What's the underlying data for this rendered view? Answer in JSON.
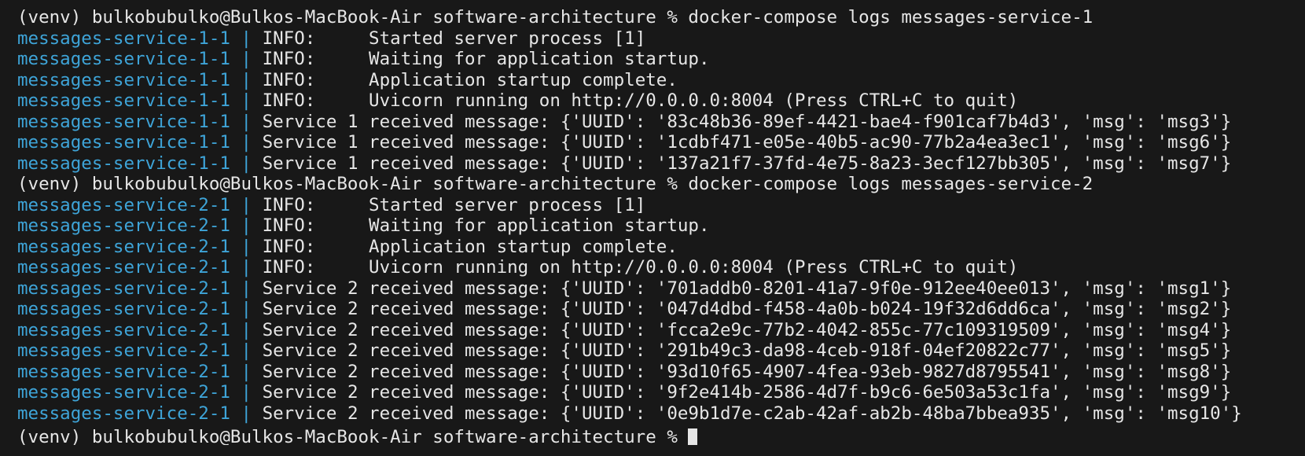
{
  "terminal": {
    "lines": [
      {
        "type": "prompt",
        "text": "(venv) bulkobubulko@Bulkos-MacBook-Air software-architecture % docker-compose logs messages-service-1"
      },
      {
        "type": "log",
        "service": "messages-service-1-1",
        "sep": " | ",
        "message": "INFO:     Started server process [1]"
      },
      {
        "type": "log",
        "service": "messages-service-1-1",
        "sep": " | ",
        "message": "INFO:     Waiting for application startup."
      },
      {
        "type": "log",
        "service": "messages-service-1-1",
        "sep": " | ",
        "message": "INFO:     Application startup complete."
      },
      {
        "type": "log",
        "service": "messages-service-1-1",
        "sep": " | ",
        "message": "INFO:     Uvicorn running on http://0.0.0.0:8004 (Press CTRL+C to quit)"
      },
      {
        "type": "log",
        "service": "messages-service-1-1",
        "sep": " | ",
        "message": "Service 1 received message: {'UUID': '83c48b36-89ef-4421-bae4-f901caf7b4d3', 'msg': 'msg3'}"
      },
      {
        "type": "log",
        "service": "messages-service-1-1",
        "sep": " | ",
        "message": "Service 1 received message: {'UUID': '1cdbf471-e05e-40b5-ac90-77b2a4ea3ec1', 'msg': 'msg6'}"
      },
      {
        "type": "log",
        "service": "messages-service-1-1",
        "sep": " | ",
        "message": "Service 1 received message: {'UUID': '137a21f7-37fd-4e75-8a23-3ecf127bb305', 'msg': 'msg7'}"
      },
      {
        "type": "prompt",
        "text": "(venv) bulkobubulko@Bulkos-MacBook-Air software-architecture % docker-compose logs messages-service-2"
      },
      {
        "type": "log",
        "service": "messages-service-2-1",
        "sep": " | ",
        "message": "INFO:     Started server process [1]"
      },
      {
        "type": "log",
        "service": "messages-service-2-1",
        "sep": " | ",
        "message": "INFO:     Waiting for application startup."
      },
      {
        "type": "log",
        "service": "messages-service-2-1",
        "sep": " | ",
        "message": "INFO:     Application startup complete."
      },
      {
        "type": "log",
        "service": "messages-service-2-1",
        "sep": " | ",
        "message": "INFO:     Uvicorn running on http://0.0.0.0:8004 (Press CTRL+C to quit)"
      },
      {
        "type": "log",
        "service": "messages-service-2-1",
        "sep": " | ",
        "message": "Service 2 received message: {'UUID': '701addb0-8201-41a7-9f0e-912ee40ee013', 'msg': 'msg1'}"
      },
      {
        "type": "log",
        "service": "messages-service-2-1",
        "sep": " | ",
        "message": "Service 2 received message: {'UUID': '047d4dbd-f458-4a0b-b024-19f32d6dd6ca', 'msg': 'msg2'}"
      },
      {
        "type": "log",
        "service": "messages-service-2-1",
        "sep": " | ",
        "message": "Service 2 received message: {'UUID': 'fcca2e9c-77b2-4042-855c-77c109319509', 'msg': 'msg4'}"
      },
      {
        "type": "log",
        "service": "messages-service-2-1",
        "sep": " | ",
        "message": "Service 2 received message: {'UUID': '291b49c3-da98-4ceb-918f-04ef20822c77', 'msg': 'msg5'}"
      },
      {
        "type": "log",
        "service": "messages-service-2-1",
        "sep": " | ",
        "message": "Service 2 received message: {'UUID': '93d10f65-4907-4fea-93eb-9827d8795541', 'msg': 'msg8'}"
      },
      {
        "type": "log",
        "service": "messages-service-2-1",
        "sep": " | ",
        "message": "Service 2 received message: {'UUID': '9f2e414b-2586-4d7f-b9c6-6e503a53c1fa', 'msg': 'msg9'}"
      },
      {
        "type": "log",
        "service": "messages-service-2-1",
        "sep": " | ",
        "message": "Service 2 received message: {'UUID': '0e9b1d7e-c2ab-42af-ab2b-48ba7bbea935', 'msg': 'msg10'}"
      },
      {
        "type": "prompt-partial",
        "text": "(venv) bulkobubulko@Bulkos-MacBook-Air software-architecture % "
      }
    ]
  },
  "colors": {
    "background": "#181818",
    "text": "#e6e6e6",
    "service_name": "#3ea4d8"
  }
}
